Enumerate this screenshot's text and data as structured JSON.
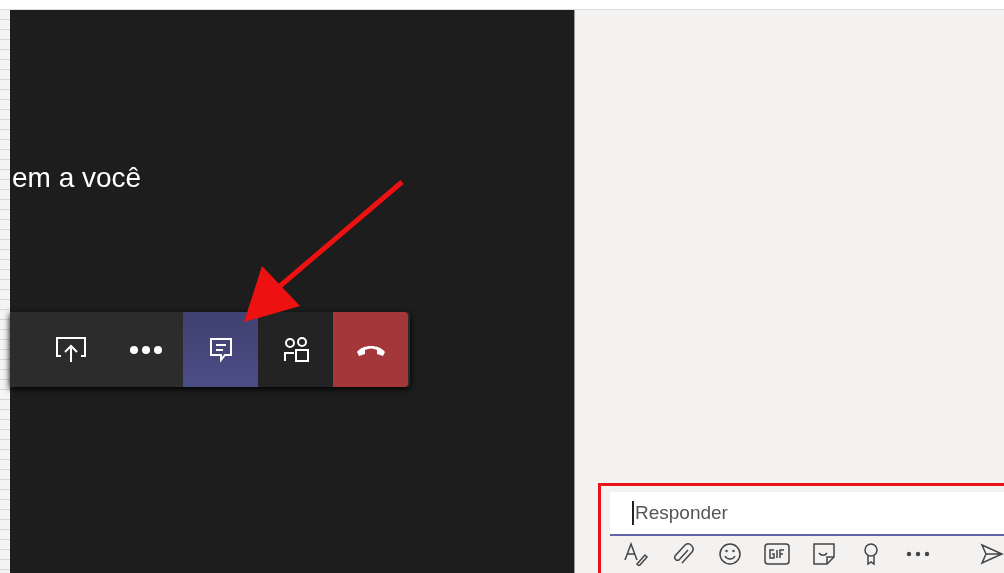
{
  "video": {
    "caption": "em a você"
  },
  "call_controls": [
    {
      "kind": "share"
    },
    {
      "kind": "more"
    },
    {
      "kind": "chat",
      "selected": true
    },
    {
      "kind": "participants",
      "selected": false
    },
    {
      "kind": "hangup"
    }
  ],
  "compose": {
    "placeholder": "Responder",
    "highlighted": true,
    "tools": [
      {
        "kind": "format"
      },
      {
        "kind": "attach"
      },
      {
        "kind": "emoji"
      },
      {
        "kind": "gif"
      },
      {
        "kind": "sticker"
      },
      {
        "kind": "praise"
      },
      {
        "kind": "more"
      },
      {
        "kind": "send"
      }
    ]
  },
  "annotation": {
    "arrow": true
  }
}
